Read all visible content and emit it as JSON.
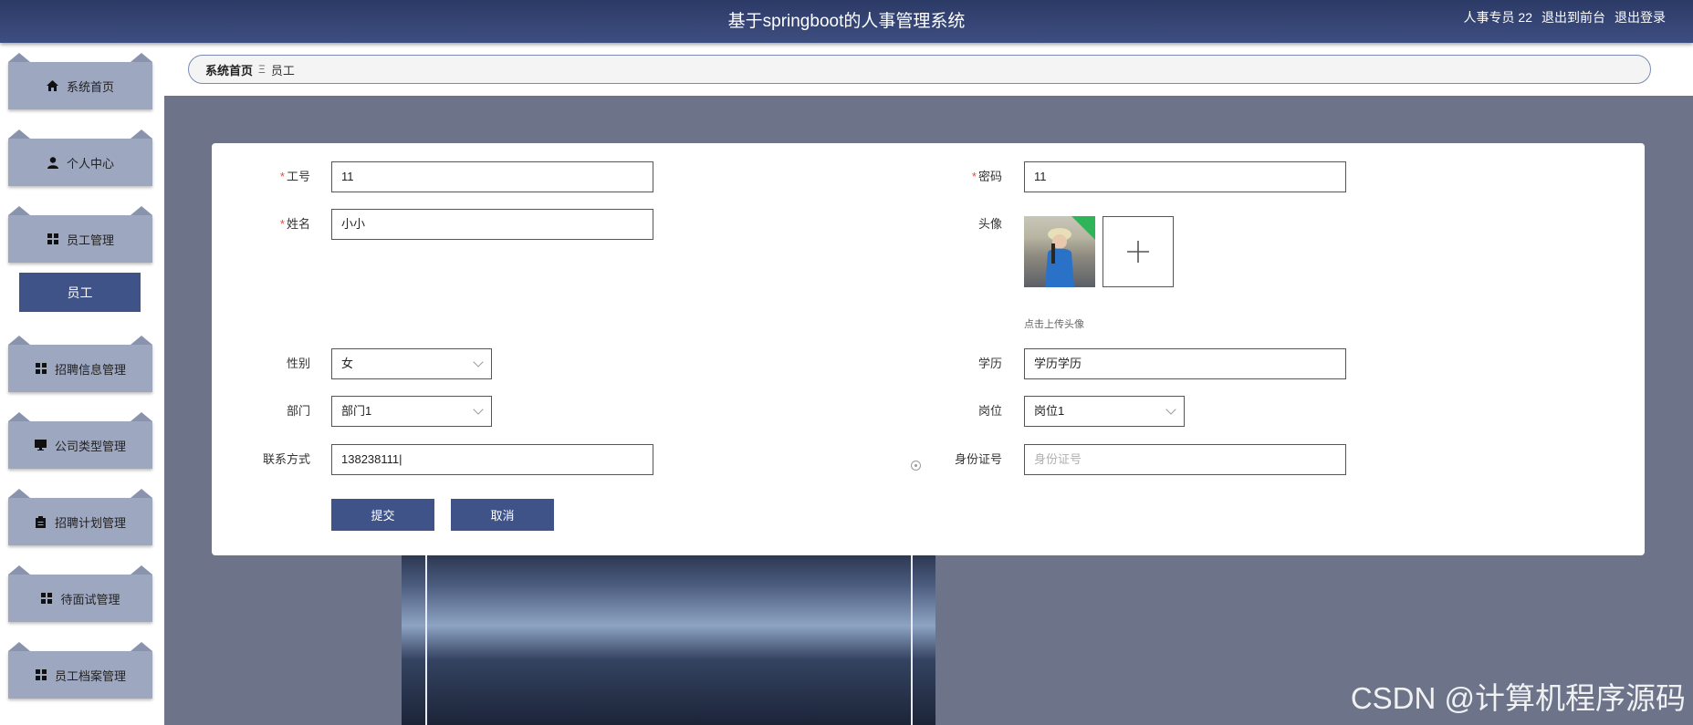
{
  "header": {
    "title": "基于springboot的人事管理系统",
    "user": "人事专员 22",
    "to_front": "退出到前台",
    "logout": "退出登录"
  },
  "sidebar": {
    "items": [
      {
        "label": "系统首页",
        "icon": "home-icon"
      },
      {
        "label": "个人中心",
        "icon": "user-icon"
      },
      {
        "label": "员工管理",
        "icon": "grid-icon"
      },
      {
        "label": "招聘信息管理",
        "icon": "grid-icon"
      },
      {
        "label": "公司类型管理",
        "icon": "monitor-icon"
      },
      {
        "label": "招聘计划管理",
        "icon": "clipboard-icon"
      },
      {
        "label": "待面试管理",
        "icon": "grid-icon"
      },
      {
        "label": "员工档案管理",
        "icon": "grid-icon"
      }
    ],
    "sub_item": "员工"
  },
  "breadcrumb": {
    "home": "系统首页",
    "separator": "Ξ",
    "current": "员工"
  },
  "form": {
    "gonghao": {
      "label": "工号",
      "value": "11"
    },
    "mima": {
      "label": "密码",
      "value": "11"
    },
    "xingming": {
      "label": "姓名",
      "value": "小小"
    },
    "touxiang": {
      "label": "头像",
      "hint": "点击上传头像"
    },
    "xingbie": {
      "label": "性别",
      "value": "女"
    },
    "xueli": {
      "label": "学历",
      "value": "学历学历"
    },
    "bumen": {
      "label": "部门",
      "value": "部门1"
    },
    "gangwei": {
      "label": "岗位",
      "value": "岗位1"
    },
    "lianxi": {
      "label": "联系方式",
      "value": "138238111|"
    },
    "shenfen": {
      "label": "身份证号",
      "placeholder": "身份证号"
    },
    "required_mark": "*",
    "submit": "提交",
    "cancel": "取消"
  },
  "watermark": "CSDN @计算机程序源码",
  "colors": {
    "header": "#2c3a66",
    "menu_bg": "#9ea7c0",
    "accent": "#3f5388",
    "required": "#e74c3c"
  }
}
